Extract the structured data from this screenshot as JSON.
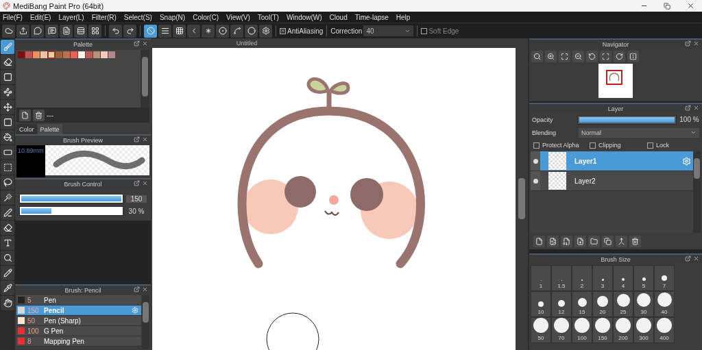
{
  "window": {
    "title": "MediBang Paint Pro (64bit)"
  },
  "menu": [
    "File(F)",
    "Edit(E)",
    "Layer(L)",
    "Filter(R)",
    "Select(S)",
    "Snap(N)",
    "Color(C)",
    "View(V)",
    "Tool(T)",
    "Window(W)",
    "Cloud",
    "Time-lapse",
    "Help"
  ],
  "toolbar": {
    "groups": [
      [
        {
          "kind": "cloud",
          "selected": false
        },
        {
          "kind": "export",
          "selected": false
        },
        {
          "kind": "comment",
          "selected": false
        },
        {
          "kind": "comment-list",
          "selected": false
        },
        {
          "kind": "page",
          "selected": false
        },
        {
          "kind": "list-edit",
          "selected": false
        },
        {
          "kind": "grid-edit",
          "selected": false
        }
      ],
      [
        {
          "kind": "undo",
          "selected": false
        },
        {
          "kind": "redo",
          "selected": false
        }
      ],
      [
        {
          "kind": "snap-off",
          "selected": true
        },
        {
          "kind": "parallel",
          "selected": false
        },
        {
          "kind": "grid",
          "selected": false
        },
        {
          "kind": "perspective",
          "selected": false
        },
        {
          "kind": "radial",
          "selected": false
        },
        {
          "kind": "concentric",
          "selected": false
        },
        {
          "kind": "curve",
          "selected": false
        },
        {
          "kind": "circle",
          "selected": false
        },
        {
          "kind": "settings",
          "selected": false
        }
      ]
    ],
    "antialiasing": {
      "label": "AntiAliasing",
      "checked": true
    },
    "correction": {
      "label": "Correction",
      "value": "40"
    },
    "soft_edge": {
      "label": "Soft Edge",
      "checked": false
    }
  },
  "tools": [
    {
      "kind": "brush",
      "selected": true
    },
    {
      "kind": "eraser",
      "selected": false
    },
    {
      "kind": "rectangle",
      "selected": false
    },
    {
      "kind": "connect",
      "selected": false
    },
    {
      "kind": "move",
      "selected": false
    },
    {
      "kind": "fill-square",
      "selected": false
    },
    {
      "kind": "bucket",
      "selected": false
    },
    {
      "kind": "gradient",
      "selected": false
    },
    {
      "kind": "select-rect",
      "selected": false
    },
    {
      "kind": "lasso",
      "selected": false
    },
    {
      "kind": "magic-wand",
      "selected": false
    },
    {
      "kind": "select-pen",
      "selected": false
    },
    {
      "kind": "select-eraser",
      "selected": false
    },
    {
      "kind": "text",
      "selected": false
    },
    {
      "kind": "zoom",
      "selected": false
    },
    {
      "kind": "pen",
      "selected": false
    },
    {
      "kind": "eyedropper",
      "selected": false
    },
    {
      "kind": "hand",
      "selected": false
    }
  ],
  "palette": {
    "title": "Palette",
    "swatches": [
      {
        "color": "#7a1010",
        "selected": false
      },
      {
        "color": "#c85050",
        "selected": false
      },
      {
        "color": "#f09060",
        "selected": false
      },
      {
        "color": "#f8c0a0",
        "selected": false
      },
      {
        "color": "#d8d8a0",
        "selected": true
      },
      {
        "color": "#a06030",
        "selected": false
      },
      {
        "color": "#c07050",
        "selected": false
      },
      {
        "color": "#f06050",
        "selected": false
      },
      {
        "color": "#fff4ec",
        "selected": false
      },
      {
        "color": "#c05858",
        "selected": false
      },
      {
        "color": "#b89080",
        "selected": false
      },
      {
        "color": "#f8c8b8",
        "selected": false
      },
      {
        "color": "#b08890",
        "selected": false
      }
    ],
    "name": "---",
    "tabs": [
      {
        "label": "Color",
        "selected": false
      },
      {
        "label": "Palette",
        "selected": true
      }
    ]
  },
  "brush_preview": {
    "title": "Brush Preview",
    "size": "10.89mm"
  },
  "brush_control": {
    "title": "Brush Control",
    "sliders": [
      {
        "level": 1,
        "reading": "150"
      },
      {
        "level": 0.3,
        "reading": "30 %"
      }
    ]
  },
  "brush_list": {
    "title": "Brush: Pencil",
    "items": [
      {
        "color": "#222222",
        "size": "5",
        "name": "Pen",
        "selected": false
      },
      {
        "color": "#d8d8d8",
        "size": "150",
        "name": "Pencil",
        "selected": true
      },
      {
        "color": "#fbe6d0",
        "size": "50",
        "name": "Pen (Sharp)",
        "selected": false
      },
      {
        "color": "#e83030",
        "size": "100",
        "name": "G Pen",
        "selected": false
      },
      {
        "color": "#e83030",
        "size": "8",
        "name": "Mapping Pen",
        "selected": false
      }
    ]
  },
  "canvas": {
    "tab": "Untitled"
  },
  "navigator": {
    "title": "Navigator",
    "buttons": [
      {
        "kind": "zoom-reset"
      },
      {
        "kind": "zoom-in"
      },
      {
        "kind": "fit"
      },
      {
        "kind": "zoom-out"
      },
      {
        "kind": "rotate-left"
      },
      {
        "kind": "fit-rotate"
      },
      {
        "kind": "rotate-right"
      },
      {
        "kind": "flip"
      }
    ]
  },
  "layer_panel": {
    "title": "Layer",
    "opacity": {
      "label": "Opacity",
      "level": 1,
      "reading": "100 %"
    },
    "blending": {
      "label": "Blending",
      "value": "Normal"
    },
    "options": [
      {
        "label": "Protect Alpha",
        "checked": false
      },
      {
        "label": "Clipping",
        "checked": false
      },
      {
        "label": "Lock",
        "checked": false
      }
    ],
    "layers": [
      {
        "name": "Layer1",
        "selected": true
      },
      {
        "name": "Layer2",
        "selected": false
      }
    ],
    "buttons": [
      {
        "kind": "new-layer"
      },
      {
        "kind": "new-halftone"
      },
      {
        "kind": "new-8bit"
      },
      {
        "kind": "add"
      },
      {
        "kind": "folder"
      },
      {
        "kind": "duplicate"
      },
      {
        "kind": "merge"
      },
      {
        "kind": "delete"
      }
    ]
  },
  "brush_size": {
    "title": "Brush Size",
    "sizes": [
      "1",
      "1.5",
      "2",
      "3",
      "4",
      "5",
      "7",
      "10",
      "12",
      "15",
      "20",
      "25",
      "30",
      "40",
      "50",
      "70",
      "100",
      "150",
      "200",
      "300",
      "400"
    ]
  }
}
